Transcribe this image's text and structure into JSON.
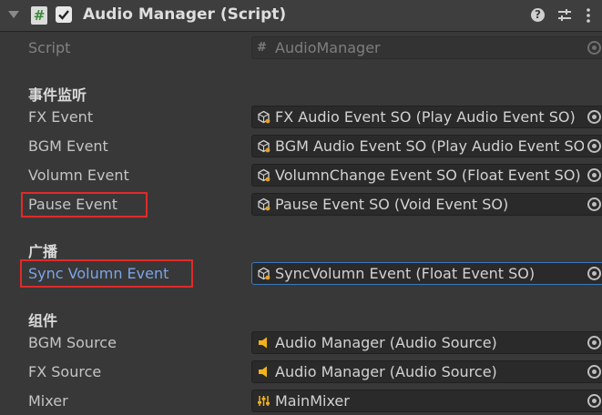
{
  "header": {
    "title": "Audio Manager (Script)",
    "enabled": true,
    "script_icon_glyph": "#",
    "help_glyph": "?"
  },
  "script_row": {
    "label": "Script",
    "value": "AudioManager",
    "icon": "script-hash-icon"
  },
  "sections": {
    "events_title": "事件监听",
    "broadcast_title": "广播",
    "components_title": "组件"
  },
  "fields": [
    {
      "label": "FX Event",
      "value": "FX Audio Event SO (Play Audio Event SO)",
      "icon": "scriptable-object-icon"
    },
    {
      "label": "BGM Event",
      "value": "BGM Audio Event SO (Play Audio Event SO)",
      "icon": "scriptable-object-icon"
    },
    {
      "label": "Volumn Event",
      "value": "VolumnChange Event SO (Float Event SO)",
      "icon": "scriptable-object-icon"
    },
    {
      "label": "Pause Event",
      "value": "Pause Event SO (Void Event SO)",
      "icon": "scriptable-object-icon"
    },
    {
      "label": "Sync Volumn Event",
      "value": "SyncVolumn Event (Float Event SO)",
      "icon": "scriptable-object-icon"
    },
    {
      "label": "BGM Source",
      "value": "Audio Manager (Audio Source)",
      "icon": "audio-source-icon"
    },
    {
      "label": "FX Source",
      "value": "Audio Manager (Audio Source)",
      "icon": "audio-source-icon"
    },
    {
      "label": "Mixer",
      "value": "MainMixer",
      "icon": "audio-mixer-icon"
    }
  ],
  "colors": {
    "background": "#383838",
    "field_background": "#2a2a2a",
    "highlight_box": "#e02a2a",
    "focused_label": "#7ba4e8",
    "focus_border": "#3a79bb"
  }
}
